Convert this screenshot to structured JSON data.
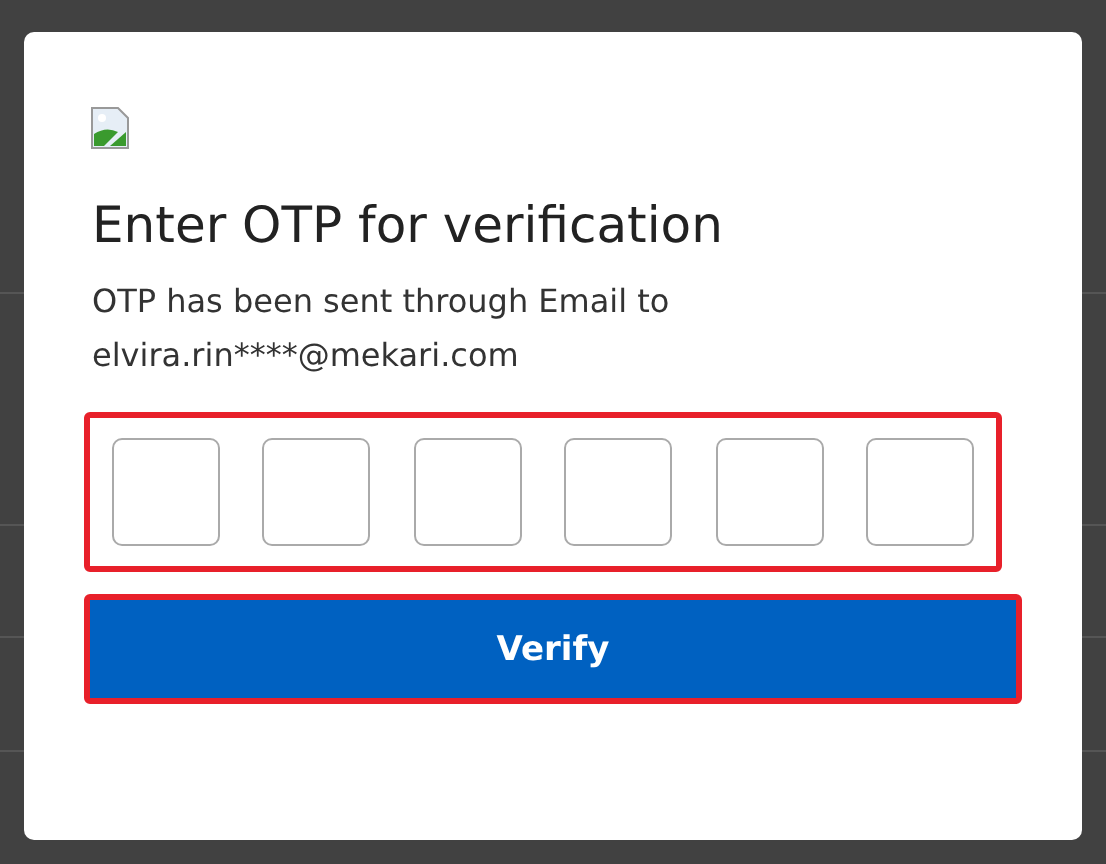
{
  "dialog": {
    "title": "Enter OTP for verification",
    "message": "OTP has been sent through Email to elvira.rin****@mekari.com",
    "otp_group": {
      "highlighted": true,
      "fields": [
        {
          "kind": "digit"
        },
        {
          "kind": "digit"
        },
        {
          "kind": "digit"
        },
        {
          "kind": "digit"
        },
        {
          "kind": "digit"
        },
        {
          "kind": "digit"
        }
      ]
    },
    "verify_button": {
      "label": "Verify",
      "highlighted": true
    }
  }
}
